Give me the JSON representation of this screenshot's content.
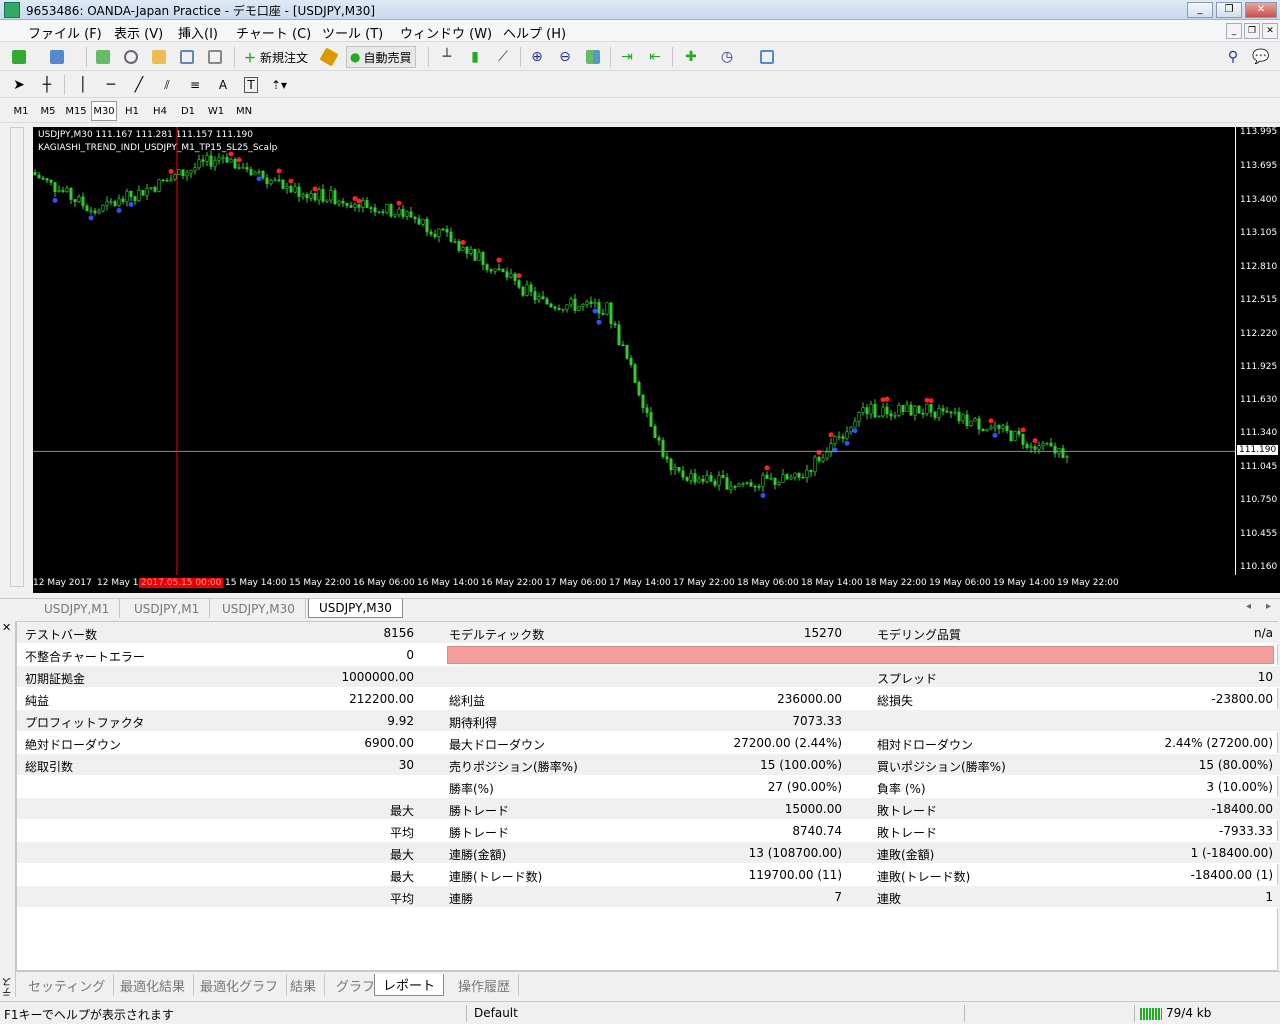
{
  "window": {
    "title": "9653486: OANDA-Japan Practice - デモ口座 - [USDJPY,M30]"
  },
  "menu": [
    "ファイル (F)",
    "表示 (V)",
    "挿入(I)",
    "チャート (C)",
    "ツール (T)",
    "ウィンドウ (W)",
    "ヘルプ (H)"
  ],
  "toolbar": {
    "new_order": "新規注文",
    "auto_trade": "自動売買"
  },
  "timeframes": [
    "M1",
    "M5",
    "M15",
    "M30",
    "H1",
    "H4",
    "D1",
    "W1",
    "MN"
  ],
  "active_timeframe": "M30",
  "chart": {
    "symbol_line": "USDJPY,M30   111.167 111.281 111.157 111.190",
    "indicator": "KAGIASHI_TREND_INDI_USDJPY_M1_TP15_SL25_Scalp",
    "current_price": "111.190",
    "cursor_date": "2017.05.15 00:00",
    "colors": {
      "background": "#000000",
      "candles": "#33cc33",
      "price_line": "#8090a0",
      "cursor": "#ff0000"
    }
  },
  "chart_data": {
    "type": "line",
    "title": "USDJPY,M30",
    "x": [
      "12 May 2017",
      "12 May 14:00",
      "15 May 06:00",
      "15 May 14:00",
      "15 May 22:00",
      "16 May 06:00",
      "16 May 14:00",
      "16 May 22:00",
      "17 May 06:00",
      "17 May 14:00",
      "17 May 22:00",
      "18 May 06:00",
      "18 May 14:00",
      "18 May 22:00",
      "19 May 06:00",
      "19 May 14:00",
      "19 May 22:00"
    ],
    "series": [
      {
        "values": [
          113.65,
          113.3,
          113.55,
          113.8,
          113.5,
          113.4,
          113.25,
          112.9,
          112.5,
          112.45,
          111.0,
          110.9,
          110.95,
          111.55,
          111.55,
          111.4,
          111.19
        ]
      }
    ],
    "y_ticks": [
      "113.995",
      "113.695",
      "113.400",
      "113.105",
      "112.810",
      "112.515",
      "112.220",
      "111.925",
      "111.630",
      "111.340",
      "111.045",
      "110.750",
      "110.455",
      "110.160"
    ],
    "ylim": [
      110.1,
      114.05
    ],
    "x_ticks": [
      "12 May 2017",
      "12 May 14:00",
      "15 May 06:00",
      "15 May 14:00",
      "15 May 22:00",
      "16 May 06:00",
      "16 May 14:00",
      "16 May 22:00",
      "17 May 06:00",
      "17 May 14:00",
      "17 May 22:00",
      "18 May 06:00",
      "18 May 14:00",
      "18 May 22:00",
      "19 May 06:00",
      "19 May 14:00",
      "19 May 22:00"
    ],
    "grid": false
  },
  "chart_tabs": [
    "USDJPY,M1",
    "USDJPY,M1",
    "USDJPY,M30",
    "USDJPY,M30"
  ],
  "active_chart_tab": 3,
  "report": {
    "rows": [
      [
        "テストバー数",
        "8156",
        "",
        "モデルティック数",
        "15270",
        "モデリング品質",
        "n/a"
      ],
      [
        "不整合チャートエラー",
        "0",
        "",
        "",
        "",
        "",
        ""
      ],
      [
        "初期証拠金",
        "1000000.00",
        "",
        "",
        "",
        "スプレッド",
        "10"
      ],
      [
        "純益",
        "212200.00",
        "",
        "総利益",
        "236000.00",
        "総損失",
        "-23800.00"
      ],
      [
        "プロフィットファクタ",
        "9.92",
        "",
        "期待利得",
        "7073.33",
        "",
        ""
      ],
      [
        "絶対ドローダウン",
        "6900.00",
        "",
        "最大ドローダウン",
        "27200.00 (2.44%)",
        "相対ドローダウン",
        "2.44% (27200.00)"
      ],
      [
        "総取引数",
        "30",
        "",
        "売りポジション(勝率%)",
        "15 (100.00%)",
        "買いポジション(勝率%)",
        "15 (80.00%)"
      ],
      [
        "",
        "",
        "",
        "勝率(%)",
        "27 (90.00%)",
        "負率 (%)",
        "3 (10.00%)"
      ],
      [
        "",
        "最大",
        "",
        "勝トレード",
        "15000.00",
        "敗トレード",
        "-18400.00"
      ],
      [
        "",
        "平均",
        "",
        "勝トレード",
        "8740.74",
        "敗トレード",
        "-7933.33"
      ],
      [
        "",
        "最大",
        "",
        "連勝(金額)",
        "13 (108700.00)",
        "連敗(金額)",
        "1 (-18400.00)"
      ],
      [
        "",
        "最大",
        "",
        "連勝(トレード数)",
        "119700.00 (11)",
        "連敗(トレード数)",
        "-18400.00 (1)"
      ],
      [
        "",
        "平均",
        "",
        "連勝",
        "7",
        "連敗",
        "1"
      ]
    ]
  },
  "bottom_tabs": [
    "セッティング",
    "最適化結果",
    "最適化グラフ",
    "結果",
    "グラフ",
    "レポート",
    "操作履歴"
  ],
  "active_bottom_tab": 5,
  "side_label": "テスター",
  "status": {
    "help": "F1キーでヘルプが表示されます",
    "profile": "Default",
    "traffic": "79/4 kb"
  }
}
